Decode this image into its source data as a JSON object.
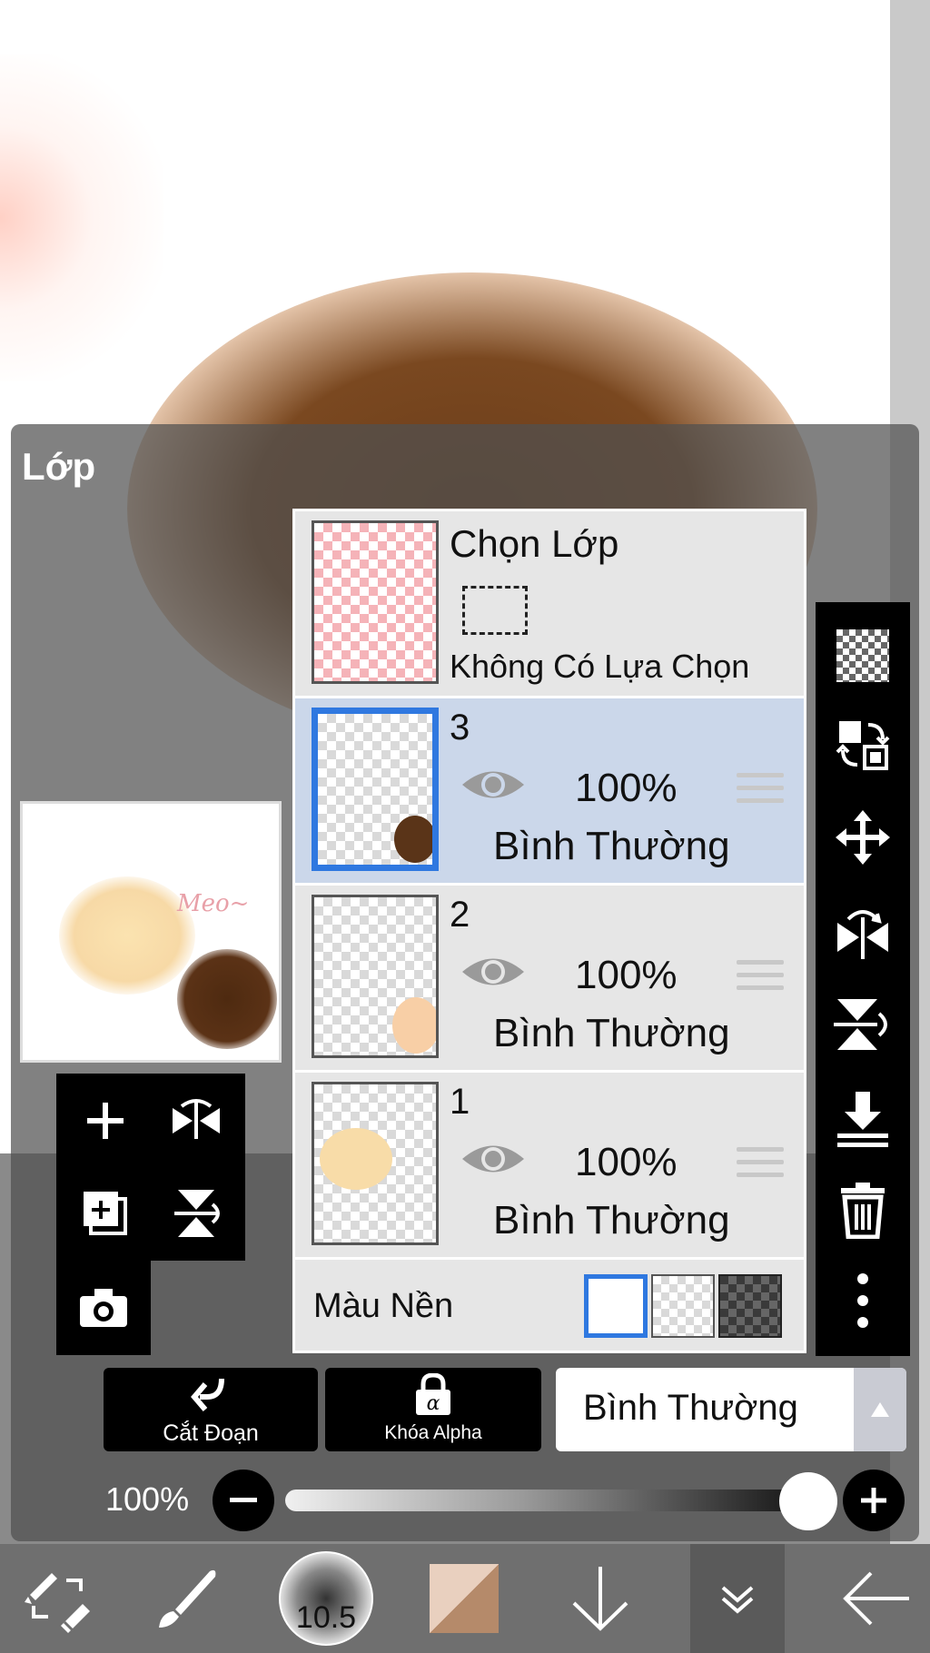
{
  "panel": {
    "title": "Lớp"
  },
  "preview": {
    "caption": "Meo~"
  },
  "selection_layer": {
    "title": "Chọn Lớp",
    "status": "Không Có Lựa Chọn"
  },
  "layers": [
    {
      "name": "3",
      "opacity": "100%",
      "mode": "Bình Thường",
      "selected": true
    },
    {
      "name": "2",
      "opacity": "100%",
      "mode": "Bình Thường",
      "selected": false
    },
    {
      "name": "1",
      "opacity": "100%",
      "mode": "Bình Thường",
      "selected": false
    }
  ],
  "background": {
    "label": "Màu Nền",
    "options": [
      "white",
      "transparent",
      "dark-checker"
    ],
    "selected": "white"
  },
  "actions": {
    "clipping_label": "Cắt Đoạn",
    "alpha_lock_label": "Khóa Alpha"
  },
  "blend": {
    "value": "Bình Thường"
  },
  "opacity": {
    "label": "100%",
    "value": 1.0
  },
  "brush": {
    "size": "10.5"
  },
  "colors": {
    "accent": "#2f78e0",
    "selected_row": "#cbd7ea",
    "panel_bg": "#e6e6e6",
    "brush_color": "#b58a6a"
  }
}
